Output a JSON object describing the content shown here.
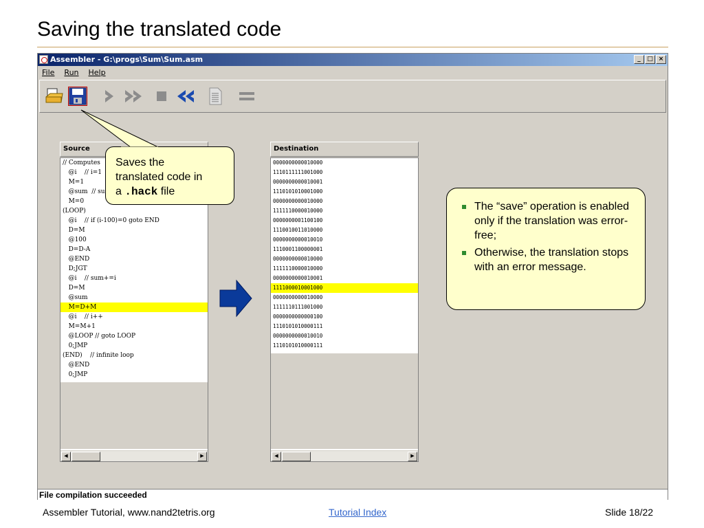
{
  "slide": {
    "title": "Saving the translated code",
    "footer_left": "Assembler Tutorial, www.nand2tetris.org",
    "footer_link": "Tutorial Index",
    "footer_right": "Slide 18/22"
  },
  "window": {
    "title": "Assembler - G:\\progs\\Sum\\Sum.asm",
    "buttons": [
      "_",
      "□",
      "×"
    ]
  },
  "menu": [
    "File",
    "Run",
    "Help"
  ],
  "toolbar": {
    "icons": [
      "load-program-icon",
      "save-icon",
      "single-step-icon",
      "fast-forward-icon",
      "stop-icon",
      "rewind-icon",
      "compare-file-icon",
      "equals-icon"
    ]
  },
  "source": {
    "title": "Source",
    "lines": [
      "// Computes",
      "   @i    // i=1",
      "   M=1",
      "   @sum  // sum=0",
      "   M=0",
      "(LOOP)",
      "   @i    // if (i-100)=0 goto END",
      "   D=M",
      "   @100",
      "   D=D-A",
      "   @END",
      "   D;JGT",
      "   @i    // sum+=i",
      "   D=M",
      "   @sum",
      "   M=D+M",
      "   @i    // i++",
      "   M=M+1",
      "   @LOOP // goto LOOP",
      "   0;JMP",
      "(END)    // infinite loop",
      "   @END",
      "   0;JMP"
    ],
    "highlight": 15
  },
  "destination": {
    "title": "Destination",
    "lines": [
      "0000000000010000",
      "1110111111001000",
      "0000000000010001",
      "1110101010001000",
      "0000000000010000",
      "1111110000010000",
      "0000000001100100",
      "1110010011010000",
      "0000000000010010",
      "1110001100000001",
      "0000000000010000",
      "1111110000010000",
      "0000000000010001",
      "1111000010001000",
      "0000000000010000",
      "1111110111001000",
      "0000000000000100",
      "1110101010000111",
      "0000000000010010",
      "1110101010000111"
    ],
    "highlight": 13
  },
  "callout": {
    "line1": "Saves the",
    "line2": "translated  code in",
    "line3_prefix": "a ",
    "line3_code": ".hack",
    "line3_suffix": " file"
  },
  "notes": [
    "The “save” operation is enabled only if the translation was error-free;",
    "Otherwise, the translation stops with an error message."
  ],
  "status": "File compilation succeeded",
  "colors": {
    "highlight": "#ffff00",
    "note_bg": "#ffffcc",
    "arrow": "#0a3a9a",
    "link": "#3366cc"
  }
}
